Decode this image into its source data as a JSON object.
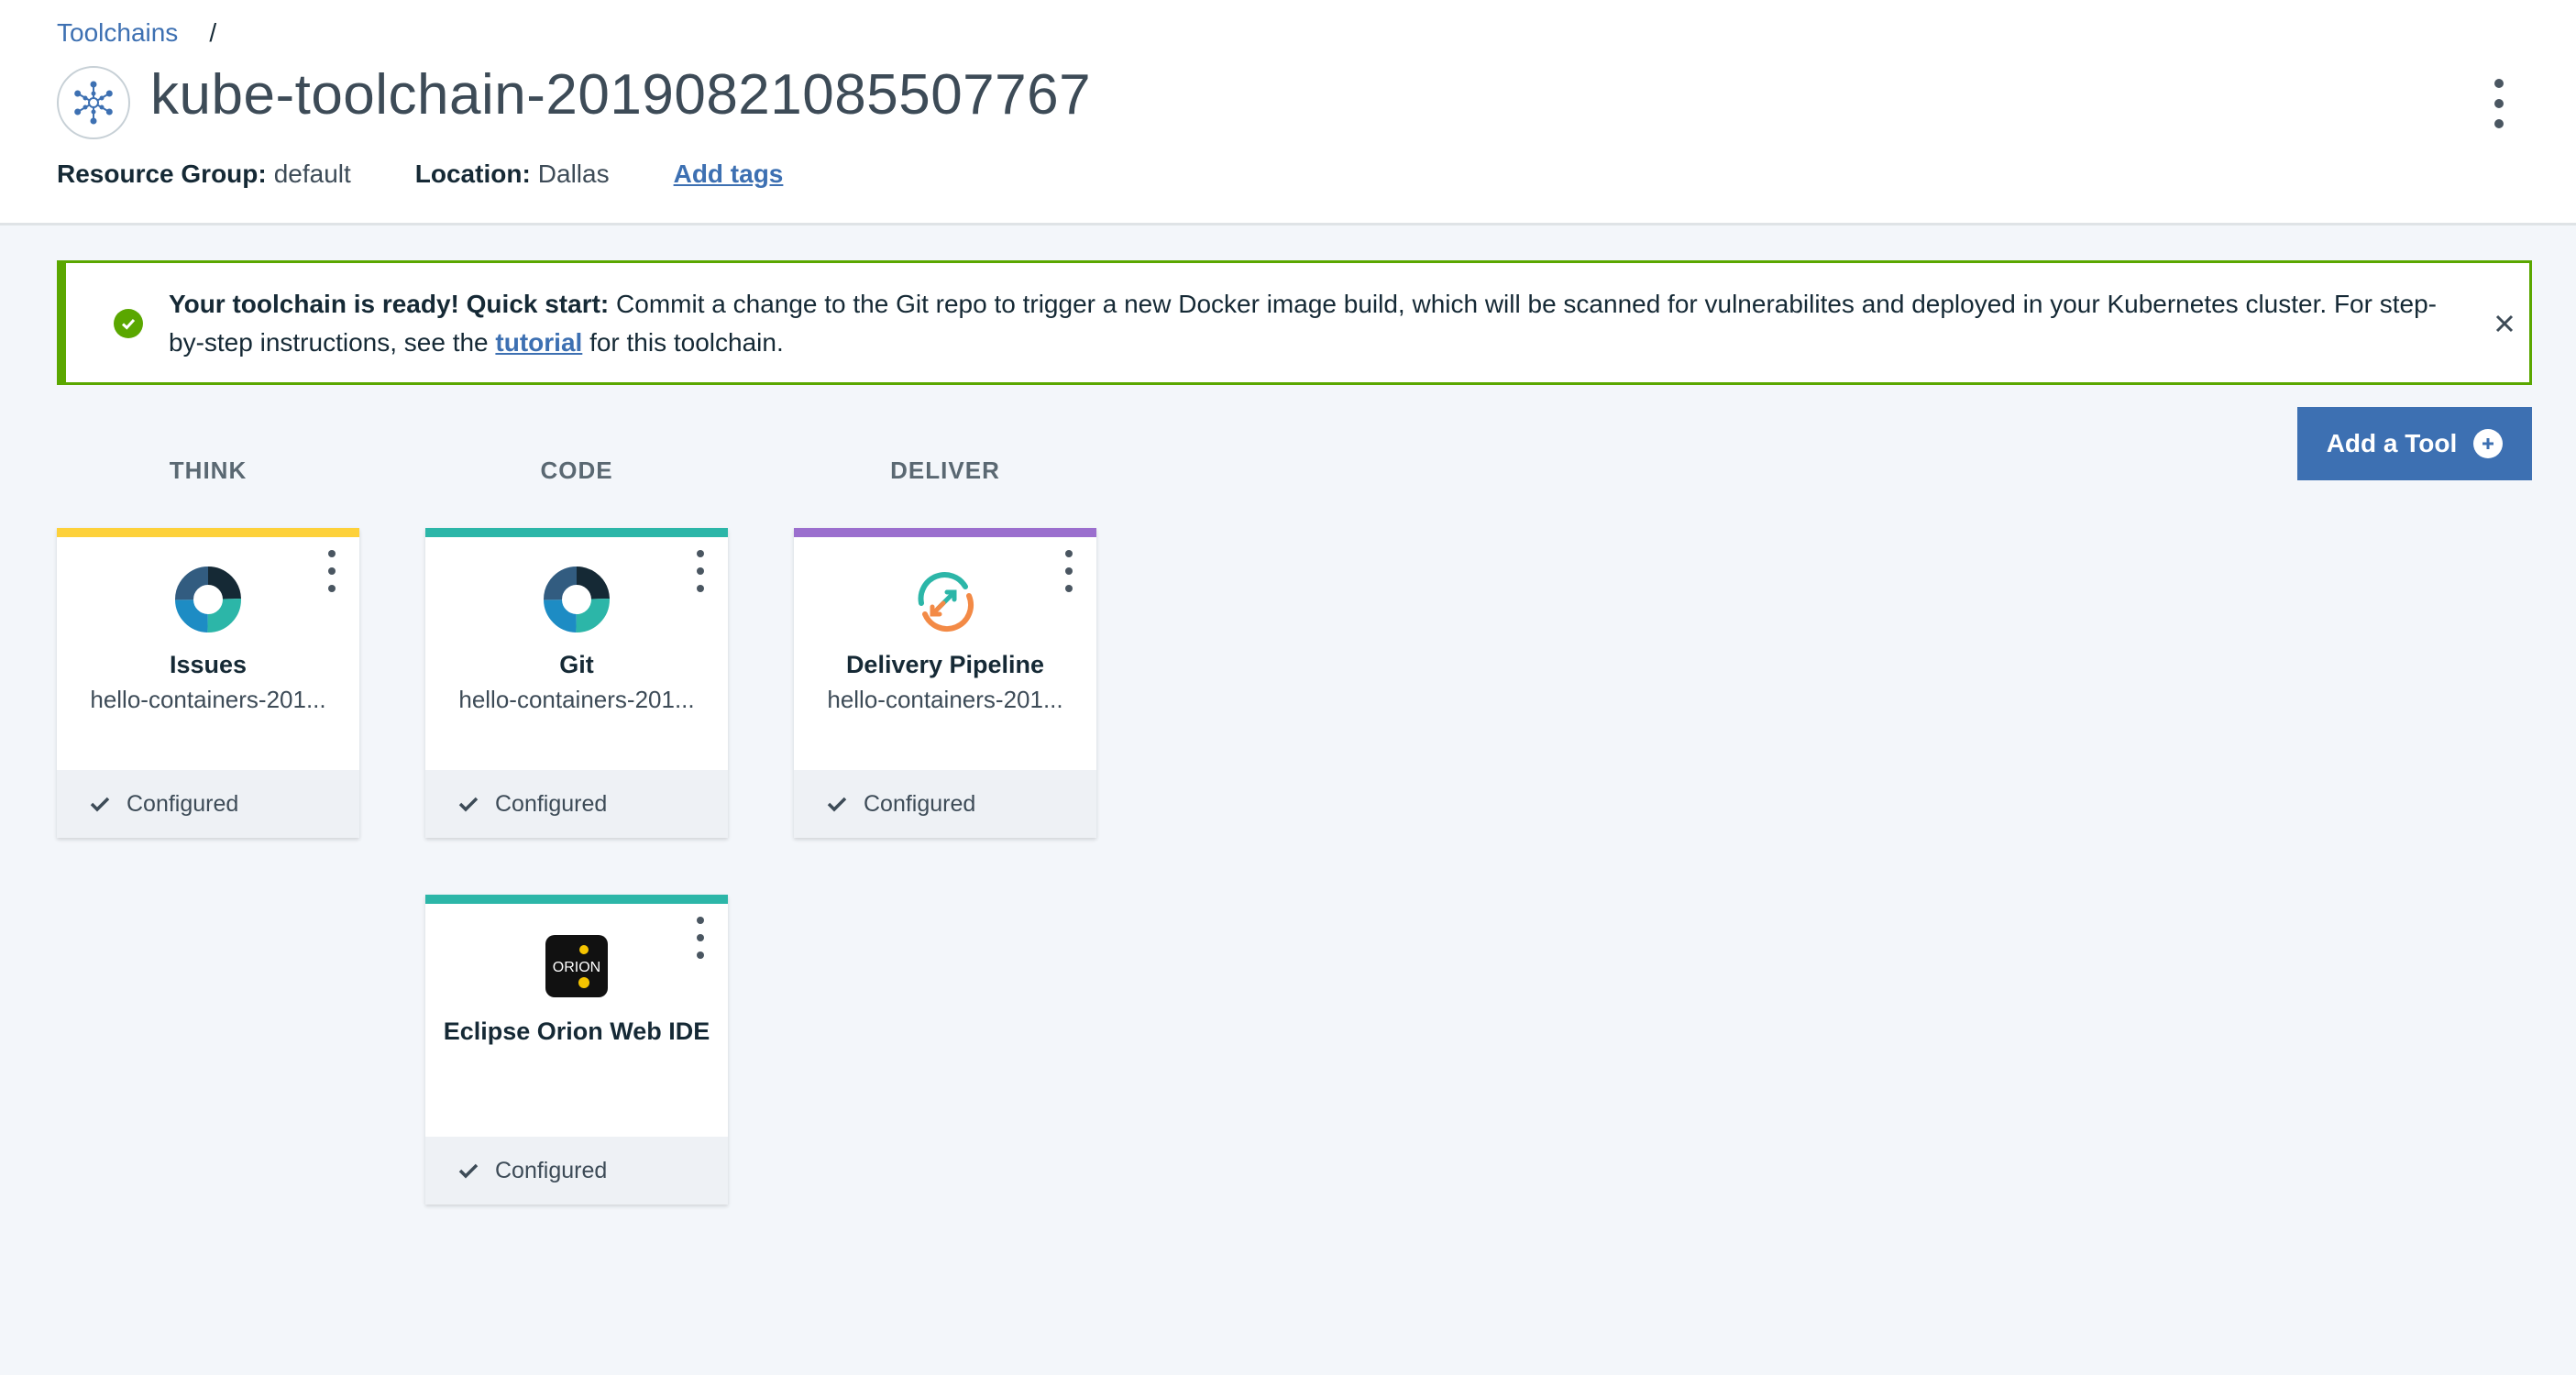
{
  "breadcrumb": {
    "root": "Toolchains",
    "separator": "/"
  },
  "header": {
    "title": "kube-toolchain-20190821085507767",
    "icon": "toolchain-icon",
    "resource_group_label": "Resource Group:",
    "resource_group_value": "default",
    "location_label": "Location:",
    "location_value": "Dallas",
    "add_tags": "Add tags"
  },
  "notification": {
    "bold": "Your toolchain is ready! Quick start:",
    "text_before_link": " Commit a change to the Git repo to trigger a new Docker image build, which will be scanned for vulnerabilites and deployed in your Kubernetes cluster. For step-by-step instructions, see the ",
    "link": "tutorial",
    "text_after_link": " for this toolchain.",
    "status_color": "#5aa700"
  },
  "actions": {
    "add_tool": "Add a Tool"
  },
  "columns": {
    "think": "THINK",
    "code": "CODE",
    "deliver": "DELIVER"
  },
  "cards": [
    {
      "name": "Issues",
      "sub": "hello-containers-201...",
      "status": "Configured",
      "bar_color": "#fdd13a",
      "icon": "issues-donut-icon"
    },
    {
      "name": "Git",
      "sub": "hello-containers-201...",
      "status": "Configured",
      "bar_color": "#2cb6a8",
      "icon": "git-donut-icon"
    },
    {
      "name": "Delivery Pipeline",
      "sub": "hello-containers-201...",
      "status": "Configured",
      "bar_color": "#9b6fce",
      "icon": "delivery-pipeline-icon"
    },
    {
      "name": "Eclipse Orion Web IDE",
      "sub": "",
      "status": "Configured",
      "bar_color": "#2cb6a8",
      "icon": "orion-icon"
    }
  ],
  "colors": {
    "accent": "#3d70b2",
    "background": "#f3f6fa"
  }
}
